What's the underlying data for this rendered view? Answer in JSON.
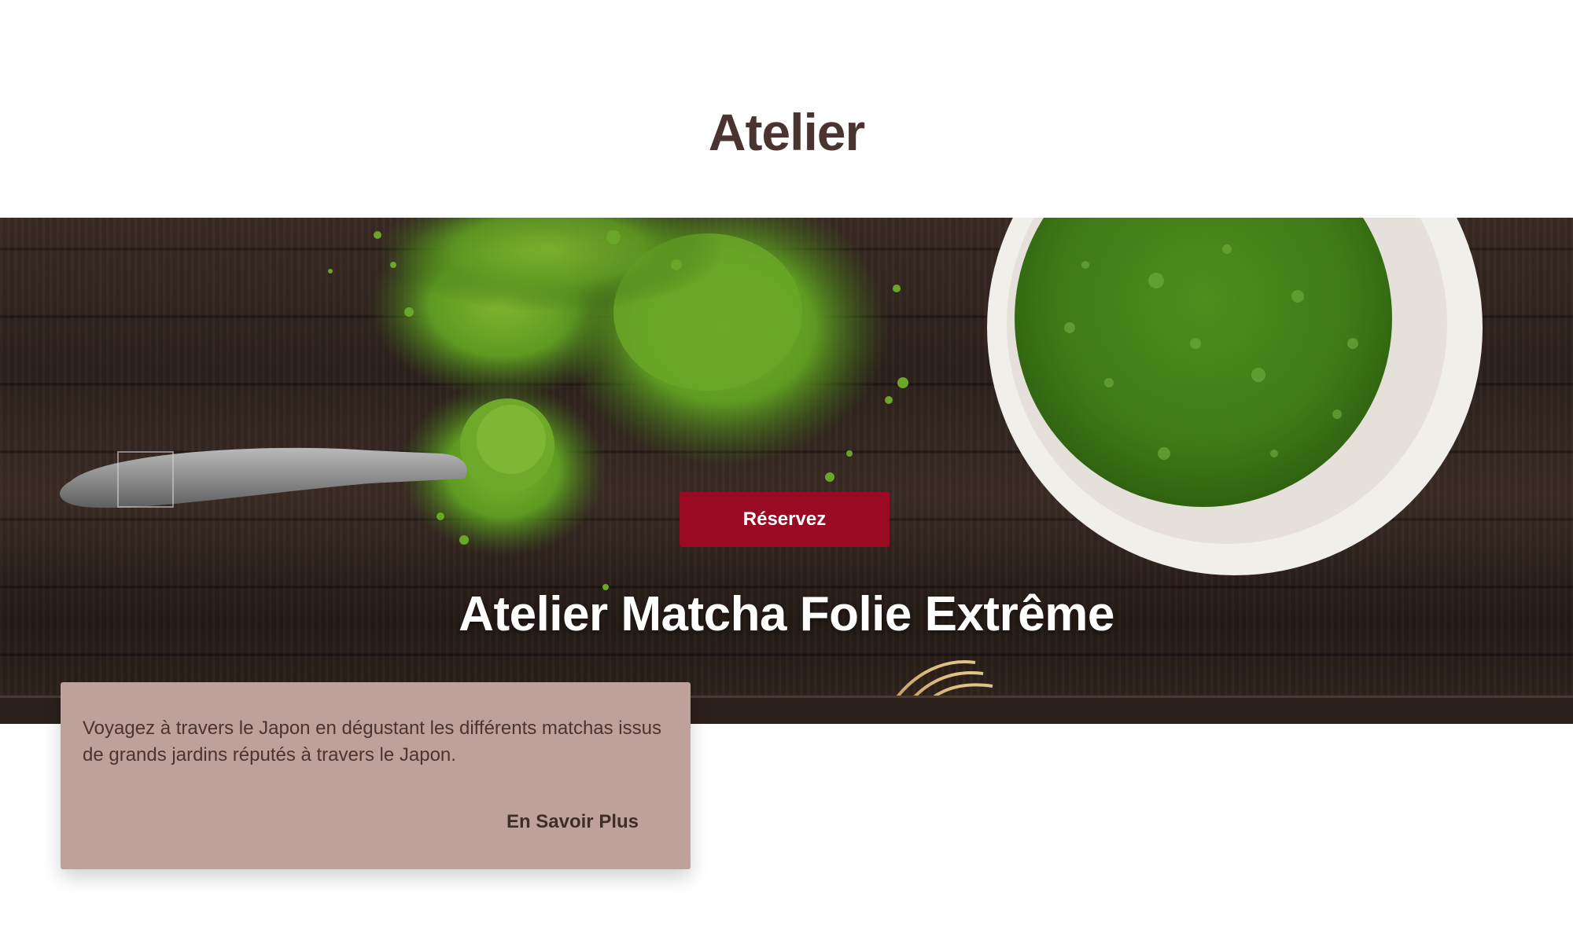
{
  "page": {
    "title": "Atelier"
  },
  "hero": {
    "image": "matcha-tea-image",
    "reserve_label": "Réservez",
    "title": "Atelier Matcha Folie Extrême"
  },
  "card": {
    "description": "Voyagez à travers le Japon en dégustant les différents matchas issus de grands jardins réputés à travers le Japon.",
    "link_label": "En Savoir Plus"
  },
  "colors": {
    "title_text": "#4a3431",
    "button_bg": "#9a0a22",
    "card_bg": "#bfa19c",
    "matcha_green": "#5e9a22"
  }
}
